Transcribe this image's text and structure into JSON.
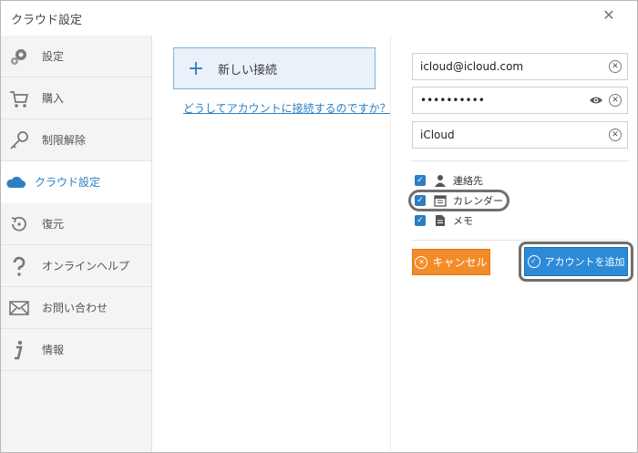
{
  "window": {
    "title": "クラウド設定",
    "close_glyph": "✕"
  },
  "sidebar": {
    "items": [
      {
        "label": "設定",
        "icon": "gear-icon"
      },
      {
        "label": "購入",
        "icon": "cart-icon"
      },
      {
        "label": "制限解除",
        "icon": "key-icon"
      },
      {
        "label": "クラウド設定",
        "icon": "cloud-icon",
        "active": true
      },
      {
        "label": "復元",
        "icon": "restore-icon"
      },
      {
        "label": "オンラインヘルプ",
        "icon": "question-icon"
      },
      {
        "label": "お問い合わせ",
        "icon": "mail-icon"
      },
      {
        "label": "情報",
        "icon": "info-icon"
      }
    ]
  },
  "middle": {
    "new_connection_label": "新しい接続",
    "new_connection_glyph": "+",
    "help_link": "どうしてアカウントに接続するのですか？"
  },
  "form": {
    "email_value": "icloud@icloud.com",
    "password_value": "••••••••••",
    "name_value": "iCloud",
    "clear_glyph": "✕",
    "options": [
      {
        "label": "連絡先",
        "checked": true,
        "icon": "person-icon"
      },
      {
        "label": "カレンダー",
        "checked": true,
        "icon": "calendar-icon"
      },
      {
        "label": "メモ",
        "checked": true,
        "icon": "note-icon"
      }
    ],
    "check_glyph": "✓"
  },
  "buttons": {
    "cancel_label": "キャンセル",
    "add_label": "アカウントを追加",
    "cancel_glyph": "✕",
    "add_glyph": "✓"
  },
  "colors": {
    "accent": "#2b7fc2",
    "cancel": "#f28c28",
    "add": "#2d8ad6"
  }
}
